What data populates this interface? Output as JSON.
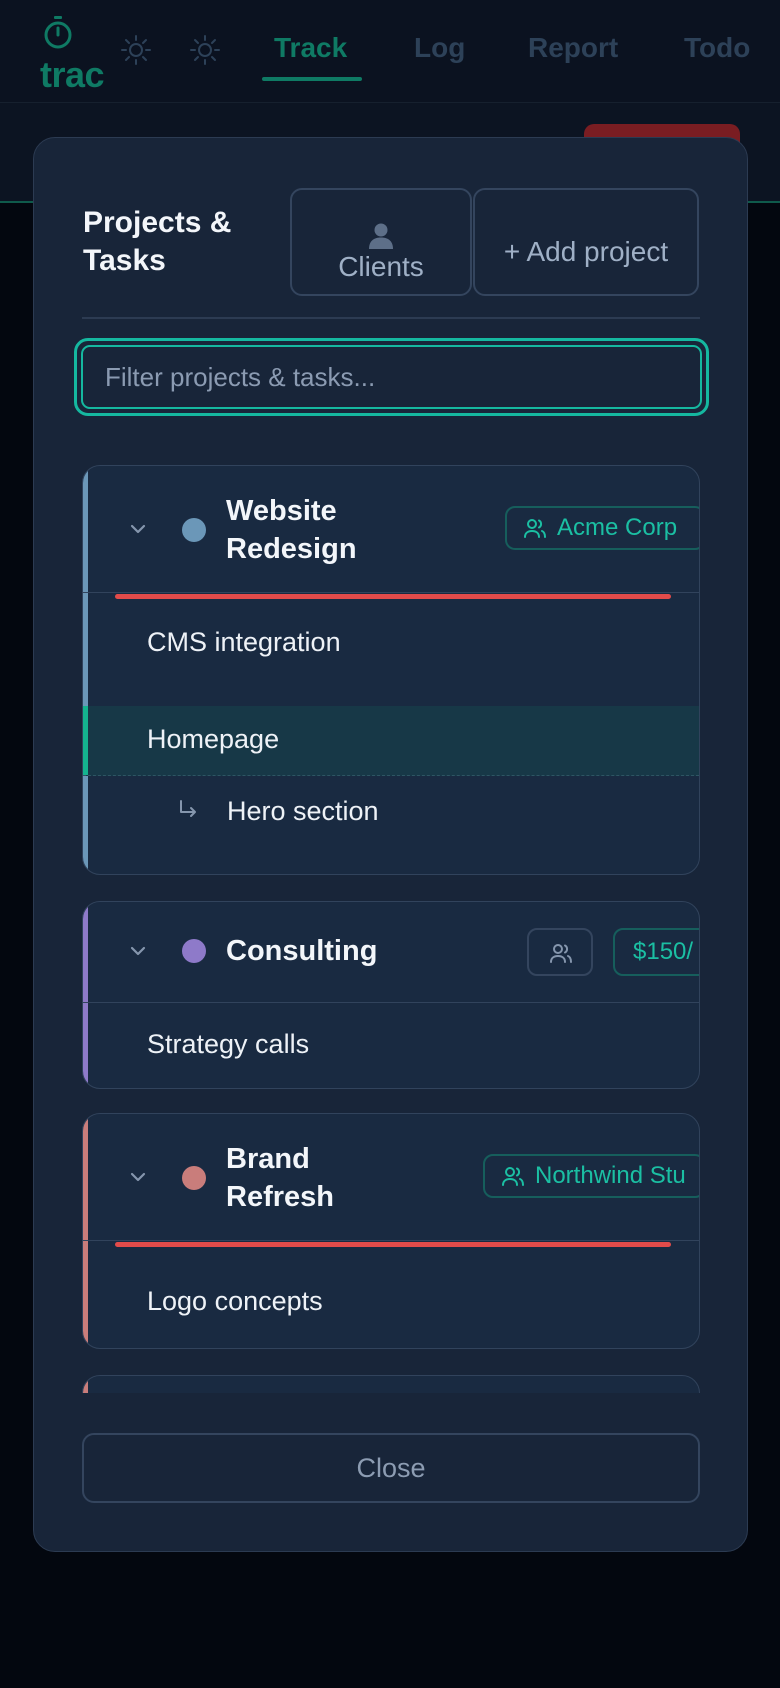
{
  "app": {
    "logo_text": "trac"
  },
  "nav": {
    "tabs": [
      {
        "label": "Track",
        "active": true
      },
      {
        "label": "Log",
        "active": false
      },
      {
        "label": "Report",
        "active": false
      },
      {
        "label": "Todo",
        "active": false
      }
    ]
  },
  "modal": {
    "title": "Projects & Tasks",
    "clients_label": "Clients",
    "add_project_label": "+ Add project",
    "filter_placeholder": "Filter projects & tasks...",
    "close_label": "Close"
  },
  "projects": [
    {
      "name": "Website Redesign",
      "color": "#6b97b8",
      "client": "Acme Corp",
      "over_budget": true,
      "tasks": [
        {
          "label": "CMS integration",
          "selected": false
        },
        {
          "label": "Homepage",
          "selected": true,
          "subtasks": [
            {
              "label": "Hero section"
            }
          ]
        }
      ]
    },
    {
      "name": "Consulting",
      "color": "#8e7ac9",
      "client": "",
      "rate": "$150/",
      "over_budget": false,
      "tasks": [
        {
          "label": "Strategy calls",
          "selected": false
        }
      ]
    },
    {
      "name": "Brand Refresh",
      "color": "#c97d7b",
      "client": "Northwind Stu",
      "over_budget": true,
      "tasks": [
        {
          "label": "Logo concepts",
          "selected": false
        }
      ]
    }
  ],
  "colors": {
    "accent": "#15b8a0",
    "brand": "#0f7a64",
    "danger": "#e24b4a",
    "surface": "#182539"
  }
}
